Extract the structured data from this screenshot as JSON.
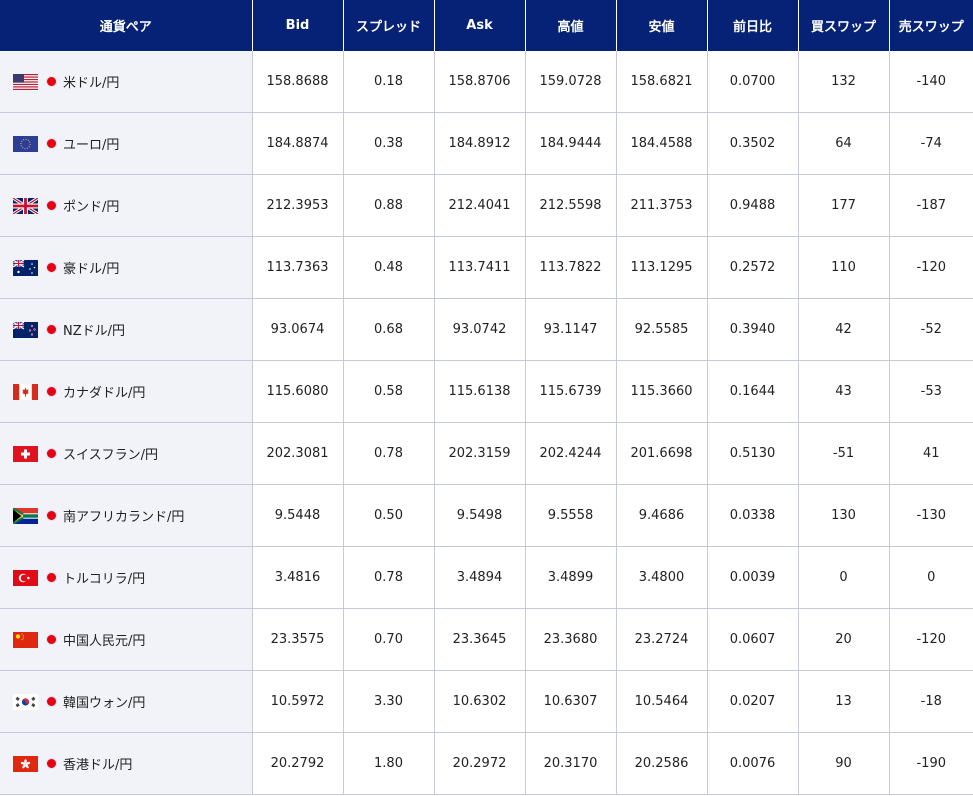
{
  "headers": [
    "通貨ペア",
    "Bid",
    "スプレッド",
    "Ask",
    "高値",
    "安値",
    "前日比",
    "買スワップ",
    "売スワップ"
  ],
  "rows": [
    {
      "flag": "us-flag-icon",
      "pair": "米ドル/円",
      "bid": "158.8688",
      "spread": "0.18",
      "ask": "158.8706",
      "high": "159.0728",
      "low": "158.6821",
      "change": "0.0700",
      "buy_swap": "132",
      "sell_swap": "-140"
    },
    {
      "flag": "eu-flag-icon",
      "pair": "ユーロ/円",
      "bid": "184.8874",
      "spread": "0.38",
      "ask": "184.8912",
      "high": "184.9444",
      "low": "184.4588",
      "change": "0.3502",
      "buy_swap": "64",
      "sell_swap": "-74"
    },
    {
      "flag": "uk-flag-icon",
      "pair": "ポンド/円",
      "bid": "212.3953",
      "spread": "0.88",
      "ask": "212.4041",
      "high": "212.5598",
      "low": "211.3753",
      "change": "0.9488",
      "buy_swap": "177",
      "sell_swap": "-187"
    },
    {
      "flag": "au-flag-icon",
      "pair": "豪ドル/円",
      "bid": "113.7363",
      "spread": "0.48",
      "ask": "113.7411",
      "high": "113.7822",
      "low": "113.1295",
      "change": "0.2572",
      "buy_swap": "110",
      "sell_swap": "-120"
    },
    {
      "flag": "nz-flag-icon",
      "pair": "NZドル/円",
      "bid": "93.0674",
      "spread": "0.68",
      "ask": "93.0742",
      "high": "93.1147",
      "low": "92.5585",
      "change": "0.3940",
      "buy_swap": "42",
      "sell_swap": "-52"
    },
    {
      "flag": "ca-flag-icon",
      "pair": "カナダドル/円",
      "bid": "115.6080",
      "spread": "0.58",
      "ask": "115.6138",
      "high": "115.6739",
      "low": "115.3660",
      "change": "0.1644",
      "buy_swap": "43",
      "sell_swap": "-53"
    },
    {
      "flag": "ch-flag-icon",
      "pair": "スイスフラン/円",
      "bid": "202.3081",
      "spread": "0.78",
      "ask": "202.3159",
      "high": "202.4244",
      "low": "201.6698",
      "change": "0.5130",
      "buy_swap": "-51",
      "sell_swap": "41"
    },
    {
      "flag": "za-flag-icon",
      "pair": "南アフリカランド/円",
      "bid": "9.5448",
      "spread": "0.50",
      "ask": "9.5498",
      "high": "9.5558",
      "low": "9.4686",
      "change": "0.0338",
      "buy_swap": "130",
      "sell_swap": "-130"
    },
    {
      "flag": "tr-flag-icon",
      "pair": "トルコリラ/円",
      "bid": "3.4816",
      "spread": "0.78",
      "ask": "3.4894",
      "high": "3.4899",
      "low": "3.4800",
      "change": "0.0039",
      "buy_swap": "0",
      "sell_swap": "0"
    },
    {
      "flag": "cn-flag-icon",
      "pair": "中国人民元/円",
      "bid": "23.3575",
      "spread": "0.70",
      "ask": "23.3645",
      "high": "23.3680",
      "low": "23.2724",
      "change": "0.0607",
      "buy_swap": "20",
      "sell_swap": "-120"
    },
    {
      "flag": "kr-flag-icon",
      "pair": "韓国ウォン/円",
      "bid": "10.5972",
      "spread": "3.30",
      "ask": "10.6302",
      "high": "10.6307",
      "low": "10.5464",
      "change": "0.0207",
      "buy_swap": "13",
      "sell_swap": "-18"
    },
    {
      "flag": "hk-flag-icon",
      "pair": "香港ドル/円",
      "bid": "20.2792",
      "spread": "1.80",
      "ask": "20.2972",
      "high": "20.3170",
      "low": "20.2586",
      "change": "0.0076",
      "buy_swap": "90",
      "sell_swap": "-190"
    }
  ],
  "colors": {
    "header_bg": "#062277",
    "pair_cell_bg": "#f1f3f9",
    "grid": "#c6c9d8",
    "jpy_dot": "#e60012"
  }
}
